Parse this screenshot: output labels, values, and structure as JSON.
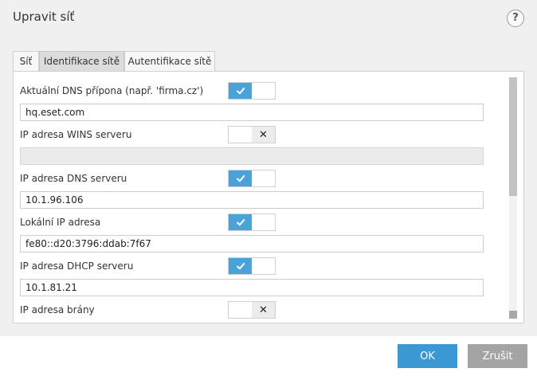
{
  "dialog": {
    "title": "Upravit síť",
    "help_label": "?"
  },
  "tabs": [
    {
      "label": "Síť",
      "active": false
    },
    {
      "label": "Identifikace sítě",
      "active": true
    },
    {
      "label": "Autentifikace sítě",
      "active": false
    }
  ],
  "rows": [
    {
      "label": "Aktuální DNS přípona (např. 'firma.cz')",
      "enabled": true,
      "value": "hq.eset.com"
    },
    {
      "label": "IP adresa WINS serveru",
      "enabled": false,
      "value": ""
    },
    {
      "label": "IP adresa DNS serveru",
      "enabled": true,
      "value": "10.1.96.106"
    },
    {
      "label": "Lokální IP adresa",
      "enabled": true,
      "value": "fe80::d20:3796:ddab:7f67"
    },
    {
      "label": "IP adresa DHCP serveru",
      "enabled": true,
      "value": "10.1.81.21"
    },
    {
      "label": "IP adresa brány",
      "enabled": false,
      "value": ""
    }
  ],
  "toggle_icons": {
    "on": "check-icon",
    "off": "cross-icon"
  },
  "footer": {
    "ok_label": "OK",
    "cancel_label": "Zrušit"
  },
  "colors": {
    "accent": "#3b98d3",
    "toggle_on": "#4aa3d8",
    "cancel": "#a4a4a4"
  }
}
